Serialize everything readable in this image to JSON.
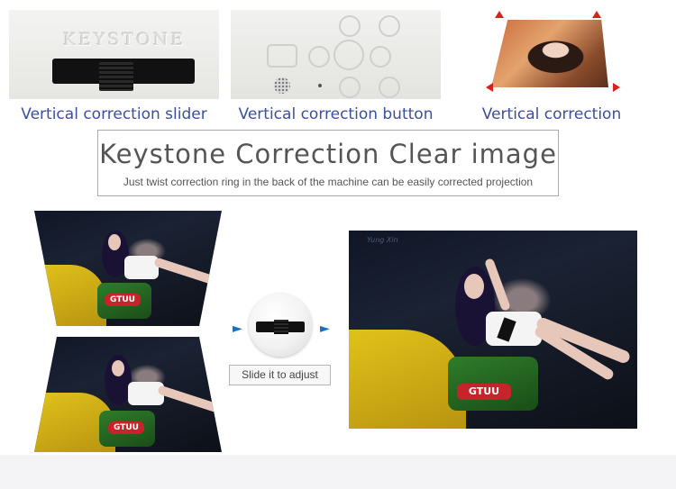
{
  "top_panels": [
    {
      "caption": "Vertical correction slider",
      "embossed_text": "KEYSTONE"
    },
    {
      "caption": "Vertical correction button"
    },
    {
      "caption": "Vertical correction"
    }
  ],
  "banner": {
    "title": "Keystone Correction Clear image",
    "subtitle": "Just twist correction ring in the back of the machine can be easily corrected projection"
  },
  "adjust_label": "Slide it to adjust",
  "photo_text": {
    "logo": "GTUU",
    "watermark": "Yung Xin"
  },
  "colors": {
    "caption": "#3a4fa0",
    "arrow": "#1a6fc4",
    "red_arrow": "#d8201c",
    "footer": "#f4f4f6"
  }
}
